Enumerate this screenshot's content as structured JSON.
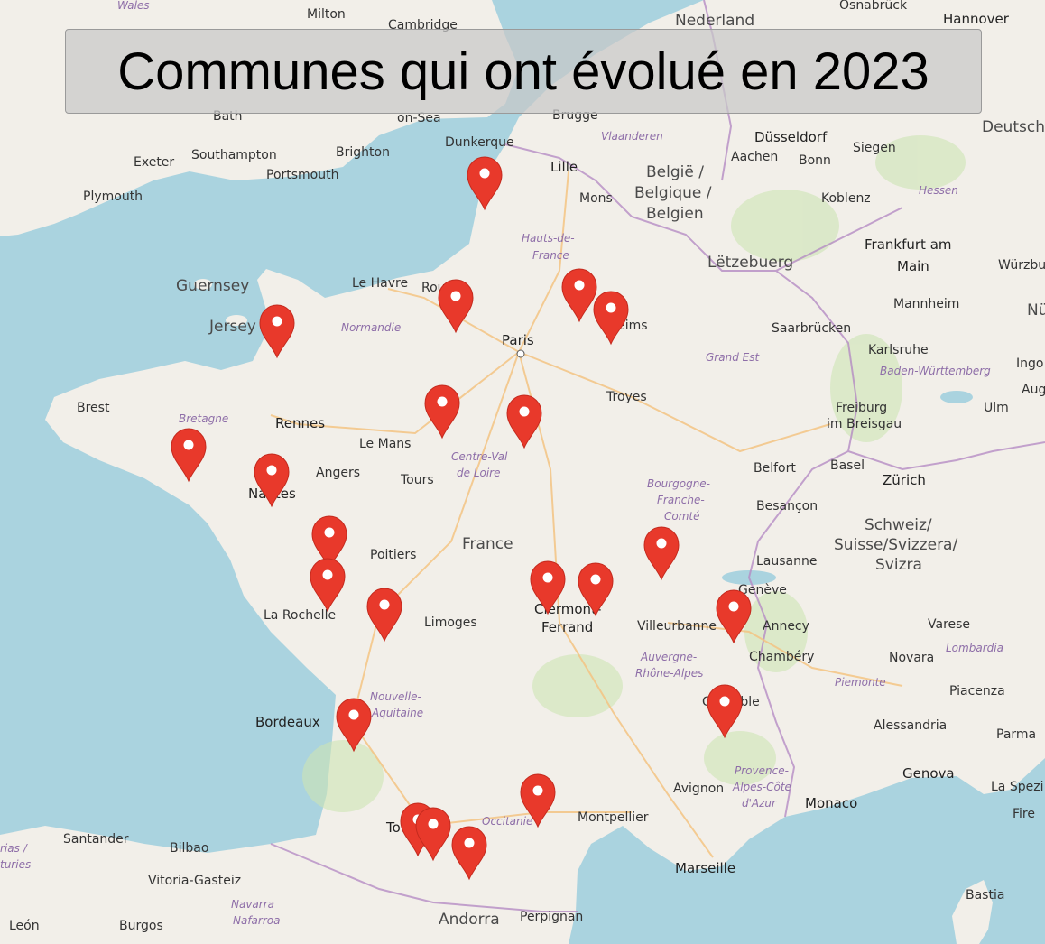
{
  "title": "Communes qui ont évolué en 2023",
  "colors": {
    "sea": "#aad3df",
    "land": "#f2efe9",
    "marker": "#e8392b",
    "border": "#b58cc4",
    "road": "#f4c483"
  },
  "marker_icon": "map-pin-icon",
  "labels": {
    "wales": "Wales",
    "milton": "Milton",
    "cambridge": "Cambridge",
    "nederland": "Nederland",
    "osnabruck": "Osnabrück",
    "hannover": "Hannover",
    "bath": "Bath",
    "onsea": "on-Sea",
    "brugge": "Brugge",
    "dusseldorf": "Düsseldorf",
    "siegen": "Siegen",
    "deutsch": "Deutsch",
    "exeter": "Exeter",
    "southampton": "Southampton",
    "brighton": "Brighton",
    "portsmouth": "Portsmouth",
    "plymouth": "Plymouth",
    "dunkerque": "Dunkerque",
    "lille": "Lille",
    "vlaanderen": "Vlaanderen",
    "aachen": "Aachen",
    "bonn": "Bonn",
    "mons": "Mons",
    "belgie": "België /",
    "belgique": "Belgique /",
    "belgien": "Belgien",
    "koblenz": "Koblenz",
    "hessen": "Hessen",
    "frankfurt": "Frankfurt am",
    "main": "Main",
    "wurzbu": "Würzbu",
    "hautsde": "Hauts-de-",
    "francereg": "France",
    "letzebuerg": "Lëtzebuerg",
    "guernsey": "Guernsey",
    "jersey": "Jersey",
    "lehavre": "Le Havre",
    "rouen": "Rouen",
    "normandie": "Normandie",
    "paris": "Paris",
    "reims": "Reims",
    "mannheim": "Mannheim",
    "nu": "Nü",
    "saarbrucken": "Saarbrücken",
    "karlsruhe": "Karlsruhe",
    "grandest": "Grand Est",
    "badenw": "Baden-Württemberg",
    "ingo": "Ingo",
    "brest": "Brest",
    "bretagne": "Bretagne",
    "rennes": "Rennes",
    "lemans": "Le Mans",
    "troyes": "Troyes",
    "freiburg": "Freiburg",
    "imbreisgau": "im Breisgau",
    "ulm": "Ulm",
    "aug": "Aug",
    "angers": "Angers",
    "tours": "Tours",
    "centrevdl": "Centre-Val",
    "deloire": "de Loire",
    "nantes": "Nantes",
    "belfort": "Belfort",
    "basel": "Basel",
    "zurich": "Zürich",
    "bourgogne": "Bourgogne-",
    "franche": "Franche-",
    "comte": "Comté",
    "besancon": "Besançon",
    "france": "France",
    "poitiers": "Poitiers",
    "schweiz": "Schweiz/",
    "suisse": "Suisse/Svizzera/",
    "svizra": "Svizra",
    "lausanne": "Lausanne",
    "geneve": "Genève",
    "larochelle": "La Rochelle",
    "limoges": "Limoges",
    "clermont": "Clermont-",
    "ferrand": "Ferrand",
    "villeurbanne": "Villeurbanne",
    "annecy": "Annecy",
    "varese": "Varese",
    "chambery": "Chambéry",
    "novara": "Novara",
    "lombardia": "Lombardia",
    "auvergne": "Auvergne-",
    "rhonealpes": "Rhône-Alpes",
    "grenoble": "Grenoble",
    "piemonte": "Piemonte",
    "piacenza": "Piacenza",
    "nouvelle": "Nouvelle-",
    "aquitaine": "Aquitaine",
    "bordeaux": "Bordeaux",
    "alessandria": "Alessandria",
    "parma": "Parma",
    "genova": "Genova",
    "laspezi": "La Spezi",
    "provence": "Provence-",
    "alpescote": "Alpes-Côte",
    "dazur": "d'Azur",
    "monaco": "Monaco",
    "avignon": "Avignon",
    "montpellier": "Montpellier",
    "occitanie": "Occitanie",
    "toulouse": "Toulouse",
    "fire": "Fire",
    "santander": "Santander",
    "bilbao": "Bilbao",
    "rias": "rias /",
    "turies": "turies",
    "marseille": "Marseille",
    "vitoria": "Vitoria-Gasteiz",
    "bastia": "Bastia",
    "navarra": "Navarra",
    "nafarroa": "Nafarroa",
    "leon": "León",
    "burgos": "Burgos",
    "andorra": "Andorra",
    "perpignan": "Perpignan"
  }
}
